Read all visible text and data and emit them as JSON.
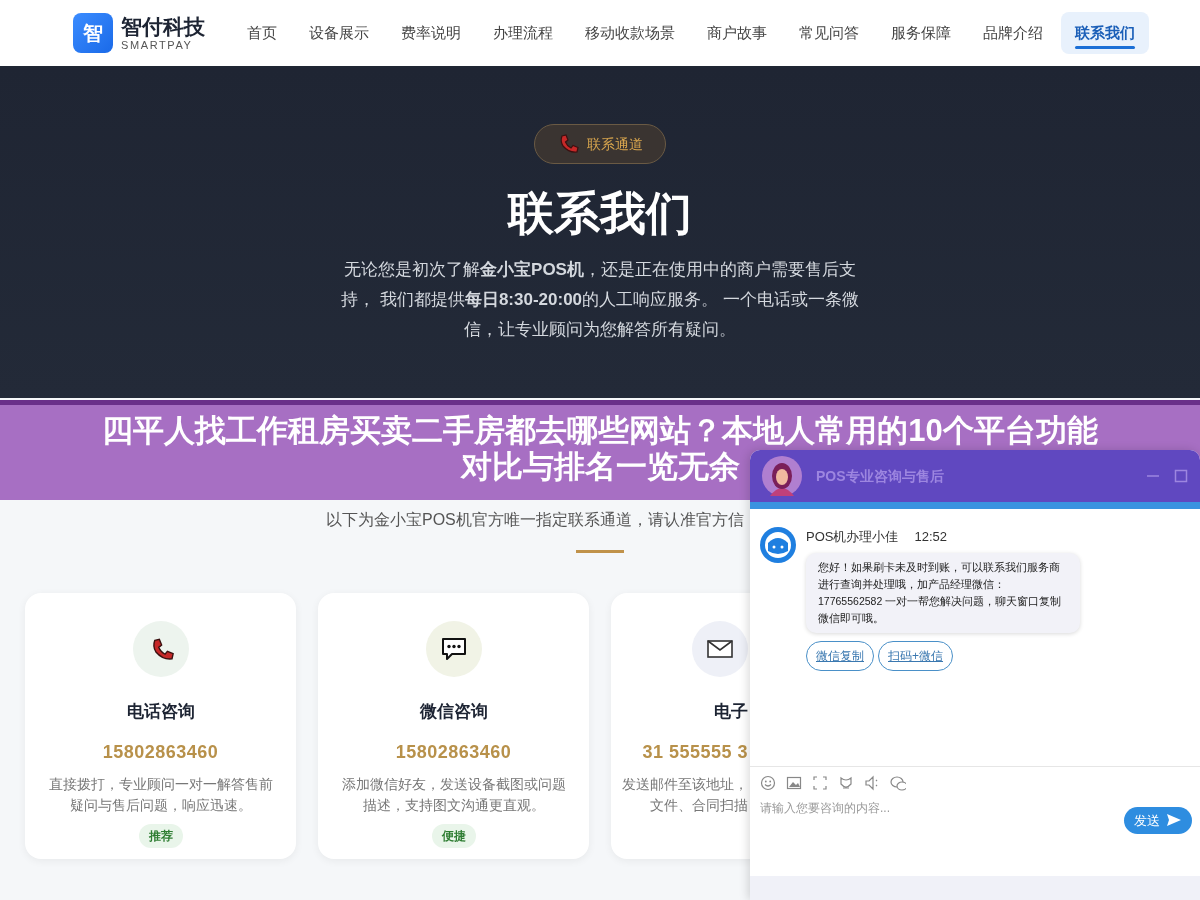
{
  "nav": {
    "logo_mark": "智",
    "brand": "智付科技",
    "brand_sub": "SMARTPAY",
    "items": [
      {
        "label": "首页",
        "selected": false
      },
      {
        "label": "设备展示",
        "selected": false
      },
      {
        "label": "费率说明",
        "selected": false
      },
      {
        "label": "办理流程",
        "selected": false
      },
      {
        "label": "移动收款场景",
        "selected": false
      },
      {
        "label": "商户故事",
        "selected": false
      },
      {
        "label": "常见问答",
        "selected": false
      },
      {
        "label": "服务保障",
        "selected": false
      },
      {
        "label": "品牌介绍",
        "selected": false
      },
      {
        "label": "联系我们",
        "selected": true
      }
    ]
  },
  "hero": {
    "badge": "联系通道",
    "title": "联系我们",
    "text": "无论您是初次了解**金小宝POS机**，还是正在使用中的商户需要售后支持， 我们都提供**每日8:30-20:00**的人工响应服务。 一个电话或一条微信，让专业顾问为您解答所有疑问。"
  },
  "section": {
    "subtitle": "以下为金小宝POS机官方唯一指定联系通道，请认准官方信",
    "cards": [
      {
        "kind": "phone",
        "title": "电话咨询",
        "value": "15802863460",
        "description": "直接拨打，专业顾问一对一解答售前疑问与售后问题，响应迅速。",
        "tag": "推荐"
      },
      {
        "kind": "chat",
        "title": "微信咨询",
        "value": "15802863460",
        "description": "添加微信好友，发送设备截图或问题描述，支持图文沟通更直观。",
        "tag": "便捷"
      },
      {
        "kind": "mail",
        "title": "电子",
        "value": "31 555555 3",
        "description_lines": [
          "发送邮件至该地址，",
          "文件、合同扫描"
        ]
      }
    ]
  },
  "overlay_banner": {
    "lines": [
      "四平人找工作租房买卖二手房都去哪些网站？本地人常用的10个平台功能",
      "对比与排名一览无余"
    ]
  },
  "chat": {
    "title": "POS专业咨询与售后",
    "messages": [
      {
        "sender": "POS机办理小佳",
        "time": "12:52",
        "text": "您好！如果刷卡未及时到账，可以联系我们服务商进行查询并处理哦，加产品经理微信：17765562582 一对一帮您解决问题，聊天窗口复制微信即可哦。",
        "actions": [
          "微信复制",
          "扫码+微信"
        ]
      }
    ],
    "input": {
      "placeholder": "请输入您要咨询的内容..."
    },
    "send": "发送"
  }
}
